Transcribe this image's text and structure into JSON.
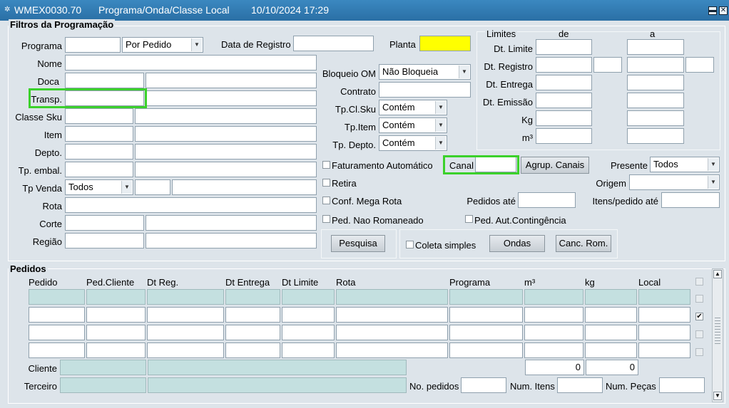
{
  "window": {
    "form_code": "WMEX0030.70",
    "title": "Programa/Onda/Classe Local",
    "datetime": "10/10/2024 17:29"
  },
  "filters": {
    "section_title": "Filtros da Programação",
    "programa_label": "Programa",
    "programa_value": "",
    "programa_mode": "Por Pedido",
    "data_registro_label": "Data de Registro",
    "planta_label": "Planta",
    "planta_value": "",
    "nome_label": "Nome",
    "doca_label": "Doca",
    "transp_label": "Transp.",
    "classe_sku_label": "Classe Sku",
    "item_label": "Item",
    "depto_label": "Depto.",
    "tp_embal_label": "Tp. embal.",
    "tp_venda_label": "Tp Venda",
    "tp_venda_value": "Todos",
    "rota_label": "Rota",
    "corte_label": "Corte",
    "regiao_label": "Região",
    "bloqueio_om_label": "Bloqueio OM",
    "bloqueio_om_value": "Não Bloqueia",
    "contrato_label": "Contrato",
    "tp_cl_sku_label": "Tp.Cl.Sku",
    "tp_cl_sku_value": "Contém",
    "tp_item_label": "Tp.Item",
    "tp_item_value": "Contém",
    "tp_depto_label": "Tp. Depto.",
    "tp_depto_value": "Contém",
    "limites": {
      "title": "Limites",
      "de": "de",
      "a": "a",
      "dt_limite": "Dt. Limite",
      "dt_registro": "Dt. Registro",
      "dt_entrega": "Dt. Entrega",
      "dt_emissao": "Dt. Emissão",
      "kg": "Kg",
      "m3": "m³"
    },
    "faturamento_automatico_label": "Faturamento Automático",
    "canal_label": "Canal",
    "agrup_canais_label": "Agrup. Canais",
    "presente_label": "Presente",
    "presente_value": "Todos",
    "retira_label": "Retira",
    "origem_label": "Origem",
    "origem_value": "",
    "conf_mega_rota_label": "Conf. Mega Rota",
    "pedidos_ate_label": "Pedidos até",
    "itens_pedido_ate_label": "Itens/pedido até",
    "ped_nao_romaneado_label": "Ped. Nao Romaneado",
    "ped_aut_contingencia_label": "Ped. Aut.Contingência",
    "pesquisa_label": "Pesquisa",
    "coleta_simples_label": "Coleta simples",
    "ondas_label": "Ondas",
    "canc_rom_label": "Canc. Rom."
  },
  "pedidos": {
    "section_title": "Pedidos",
    "columns": [
      "Pedido",
      "Ped.Cliente",
      "Dt Reg.",
      "Dt Entrega",
      "Dt Limite",
      "Rota",
      "Programa",
      "m³",
      "kg",
      "Local"
    ],
    "rows": 4,
    "row_checks": [
      false,
      true,
      false,
      false
    ],
    "header_check": false,
    "cliente_label": "Cliente",
    "terceiro_label": "Terceiro",
    "total_m3": "0",
    "total_kg": "0",
    "no_pedidos_label": "No. pedidos",
    "num_itens_label": "Num. Itens",
    "num_pecas_label": "Num. Peças"
  },
  "colors": {
    "titlebar": "#2a6fa5",
    "background": "#dde4ea",
    "field_teal": "#c4e0e0",
    "field_yellow": "#ffff00",
    "highlight": "#3bd12b"
  }
}
